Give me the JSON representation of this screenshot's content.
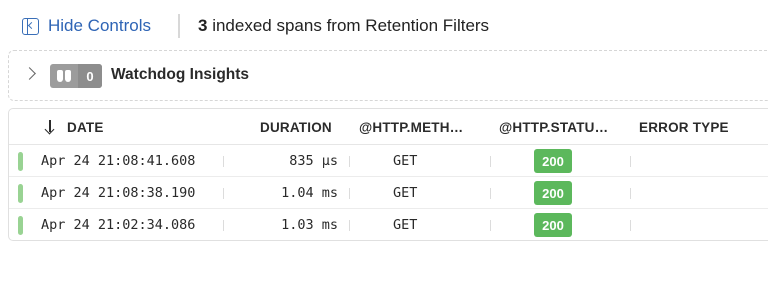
{
  "topbar": {
    "hide_controls_label": "Hide Controls",
    "span_count": "3",
    "span_text": "indexed spans from Retention Filters"
  },
  "insights": {
    "icon": "binoculars-icon",
    "count": "0",
    "title": "Watchdog Insights"
  },
  "table": {
    "columns": {
      "date": "DATE",
      "duration": "DURATION",
      "http_method": "@HTTP.METH…",
      "http_status": "@HTTP.STATU…",
      "error_type": "ERROR TYPE"
    },
    "sort": "descending",
    "rows": [
      {
        "date": "Apr 24 21:08:41.608",
        "duration": "835 µs",
        "method": "GET",
        "status": "200",
        "error_type": ""
      },
      {
        "date": "Apr 24 21:08:38.190",
        "duration": "1.04 ms",
        "method": "GET",
        "status": "200",
        "error_type": ""
      },
      {
        "date": "Apr 24 21:02:34.086",
        "duration": "1.03 ms",
        "method": "GET",
        "status": "200",
        "error_type": ""
      }
    ]
  },
  "colors": {
    "link": "#2e64b5",
    "status_ok": "#5cb85c",
    "row_indicator": "#99d393"
  }
}
